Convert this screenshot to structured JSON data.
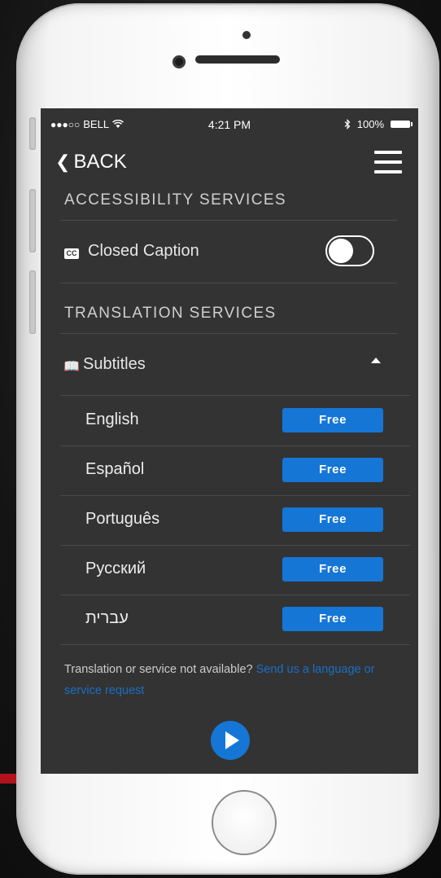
{
  "status_bar": {
    "signal": "●●●○○",
    "carrier": "BELL",
    "wifi_icon": "wifi-icon",
    "time": "4:21 PM",
    "bluetooth_icon": "bluetooth-icon",
    "battery": "100%"
  },
  "nav": {
    "back_label": "BACK",
    "menu_icon": "hamburger-menu-icon"
  },
  "accessibility": {
    "heading": "ACCESSIBILITY SERVICES",
    "closed_caption_label": "Closed Caption",
    "closed_caption_icon": "CC",
    "closed_caption_enabled": false
  },
  "translation": {
    "heading": "TRANSLATION SERVICES",
    "subtitles_label": "Subtitles",
    "subtitles_expanded": true,
    "languages": [
      {
        "name": "English",
        "price": "Free"
      },
      {
        "name": "Español",
        "price": "Free"
      },
      {
        "name": "Português",
        "price": "Free"
      },
      {
        "name": "Русский",
        "price": "Free"
      },
      {
        "name": "עברית",
        "price": "Free"
      }
    ]
  },
  "footer": {
    "text": "Translation or service not available? ",
    "link_text": "Send us a language or service request"
  },
  "colors": {
    "screen_bg": "#333333",
    "accent": "#1576d6",
    "link": "#1a6fc4"
  }
}
